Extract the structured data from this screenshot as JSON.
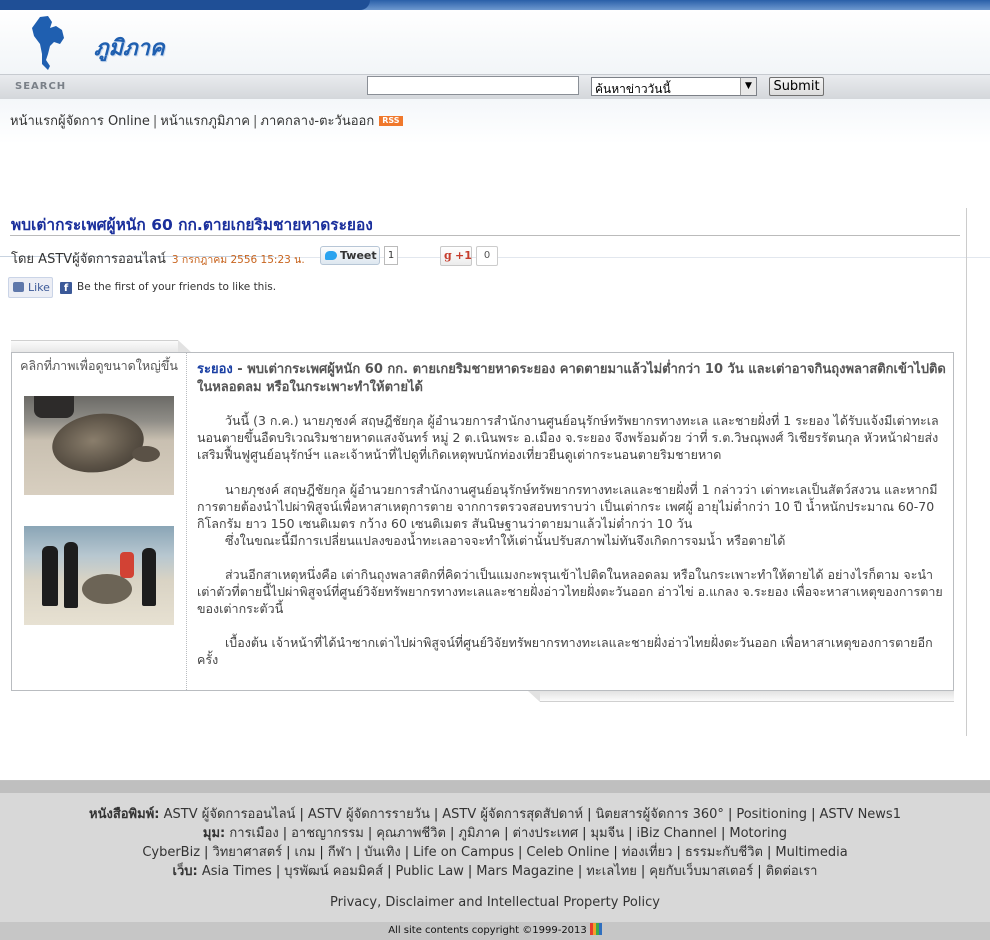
{
  "site": {
    "logo_text": "ภูมิภาค",
    "search_label": "SEARCH",
    "search_placeholder": "",
    "search_scope": "ค้นหาข่าววันนี้",
    "submit_label": "Submit"
  },
  "nav": {
    "items": [
      "หน้าแรกผู้จัดการ Online",
      "หน้าแรกภูมิภาค",
      "ภาคกลาง-ตะวันออก"
    ],
    "rss_label": "RSS"
  },
  "article": {
    "title": "พบเต่ากระเพศผู้หนัก 60 กก.ตายเกยริมชายหาดระยอง",
    "byline": "โดย ASTVผู้จัดการออนไลน์",
    "date": "3 กรกฎาคม 2556 15:23 น.",
    "tweet_label": "Tweet",
    "tweet_count": "1",
    "gplus_label": "+1",
    "gplus_count": "0",
    "fb_like_label": "Like",
    "fb_text": "Be the first of your friends to like this.",
    "photo_caption": "คลิกที่ภาพเพื่อดูขนาดใหญ่ขึ้น",
    "lead_place": "ระยอง",
    "lead_text": " - พบเต่ากระเพศผู้หนัก 60 กก. ตายเกยริมชายหาดระยอง คาดตายมาแล้วไม่ต่ำกว่า 10 วัน และเต่าอาจกินถุงพลาสติกเข้าไปติดในหลอดลม หรือในกระเพาะทำให้ตายได้",
    "paragraphs": [
      "วันนี้ (3 ก.ค.) นายภุชงค์ สฤษฎีชัยกุล ผู้อำนวยการสำนักงานศูนย์อนุรักษ์ทรัพยากรทางทะเล และชายฝั่งที่ 1 ระยอง ได้รับแจ้งมีเต่าทะเลนอนตายขึ้นอืดบริเวณริมชายหาดแสงจันทร์ หมู่ 2 ต.เนินพระ อ.เมือง จ.ระยอง จึงพร้อมด้วย ว่าที่ ร.ต.วิษณุพงศ์ วิเชียรรัตนกุล หัวหน้าฝ่ายส่งเสริมฟื้นฟูศูนย์อนุรักษ์ฯ และเจ้าหน้าที่ไปดูที่เกิดเหตุพบนักท่องเที่ยวยืนดูเต่ากระนอนตายริมชายหาด",
      "นายภุชงค์ สฤษฎีชัยกุล ผู้อำนวยการสำนักงานศูนย์อนุรักษ์ทรัพยากรทางทะเลและชายฝั่งที่ 1 กล่าวว่า เต่าทะเลเป็นสัตว์สงวน และหากมีการตายต้องนำไปผ่าพิสูจน์เพื่อหาสาเหตุการตาย จากการตรวจสอบทราบว่า เป็นเต่ากระ เพศผู้ อายุไม่ต่ำกว่า 10 ปี น้ำหนักประมาณ 60-70 กิโลกรัม ยาว 150 เซนติเมตร กว้าง 60 เซนติเมตร สันนิษฐานว่าตายมาแล้วไม่ต่ำกว่า 10 วัน",
      "ซึ่งในขณะนี้มีการเปลี่ยนแปลงของน้ำทะเลอาจจะทำให้เต่านั้นปรับสภาพไม่ทันจึงเกิดการจมน้ำ หรือตายได้",
      "ส่วนอีกสาเหตุหนึ่งคือ เต่ากินถุงพลาสติกที่คิดว่าเป็นแมงกะพรุนเข้าไปติดในหลอดลม หรือในกระเพาะทำให้ตายได้ อย่างไรก็ตาม จะนำเต่าตัวที่ตายนี้ไปผ่าพิสูจน์ที่ศูนย์วิจัยทรัพยากรทางทะเลและชายฝั่งอ่าวไทยฝั่งตะวันออก อ่าวไข่ อ.แกลง จ.ระยอง เพื่อจะหาสาเหตุของการตายของเต่ากระตัวนี้",
      "เบื้องต้น เจ้าหน้าที่ได้นำซากเต่าไปผ่าพิสูจน์ที่ศูนย์วิจัยทรัพยากรทางทะเลและชายฝั่งอ่าวไทยฝั่งตะวันออก เพื่อหาสาเหตุของการตายอีกครั้ง"
    ]
  },
  "footer": {
    "print_label": "หนังสือพิมพ์:",
    "print_items": [
      "ASTV ผู้จัดการออนไลน์",
      "ASTV ผู้จัดการรายวัน",
      "ASTV ผู้จัดการสุดสัปดาห์",
      "นิตยสารผู้จัดการ 360°",
      "Positioning",
      "ASTV News1"
    ],
    "view_label": "มุม:",
    "view_items": [
      "การเมือง",
      "อาชญากรรม",
      "คุณภาพชีวิต",
      "ภูมิภาค",
      "ต่างประเทศ",
      "มุมจีน",
      "iBiz Channel",
      "Motoring"
    ],
    "view_items2": [
      "CyberBiz",
      "วิทยาศาสตร์",
      "เกม",
      "กีฬา",
      "บันเทิง",
      "Life on Campus",
      "Celeb Online",
      "ท่องเที่ยว",
      "ธรรมะกับชีวิต",
      "Multimedia"
    ],
    "web_label": "เว็บ:",
    "web_items": [
      "Asia Times",
      "บุรพัฒน์ คอมมิคส์",
      "Public Law",
      "Mars Magazine",
      "ทะเลไทย",
      "คุยกับเว็บมาสเตอร์",
      "ติดต่อเรา"
    ],
    "privacy": "Privacy, Disclaimer and Intellectual Property Policy",
    "copyright": "All site contents copyright ©1999-2013"
  }
}
